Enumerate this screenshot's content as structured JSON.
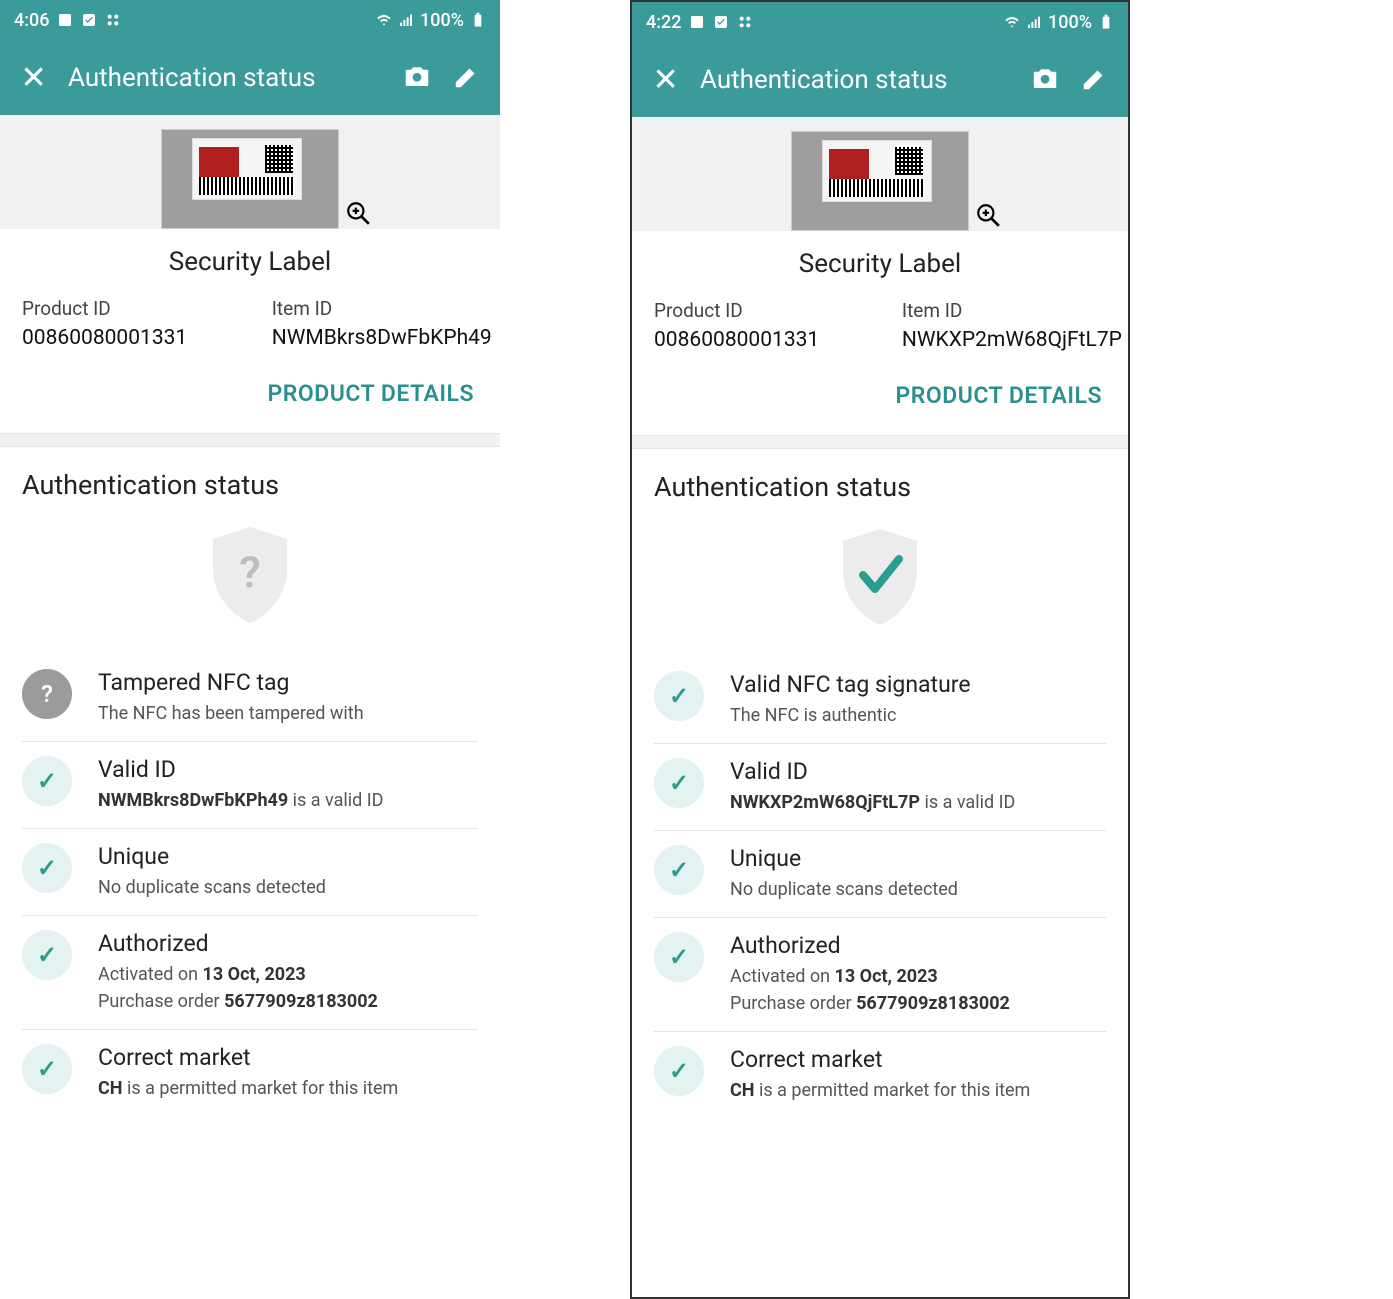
{
  "screens": [
    {
      "status_bar": {
        "time": "4:06",
        "battery": "100%"
      },
      "app_bar": {
        "title": "Authentication status"
      },
      "hero": {
        "label_title": "Security Label",
        "product_id_label": "Product ID",
        "product_id_value": "00860080001331",
        "item_id_label": "Item ID",
        "item_id_value": "NWMBkrs8DwFbKPh49",
        "details_link": "PRODUCT DETAILS"
      },
      "auth": {
        "section_title": "Authentication status",
        "shield_symbol": "?",
        "shield_ok": false,
        "items": [
          {
            "badge": "warn",
            "title": "Tampered NFC tag",
            "sub_prefix": "",
            "sub_bold": "",
            "sub_suffix": "The NFC has been tampered with",
            "extra_prefix": "",
            "extra_bold": "",
            "extra_suffix": ""
          },
          {
            "badge": "ok",
            "title": "Valid ID",
            "sub_prefix": "",
            "sub_bold": "NWMBkrs8DwFbKPh49",
            "sub_suffix": " is a valid ID",
            "extra_prefix": "",
            "extra_bold": "",
            "extra_suffix": ""
          },
          {
            "badge": "ok",
            "title": "Unique",
            "sub_prefix": "",
            "sub_bold": "",
            "sub_suffix": "No duplicate scans detected",
            "extra_prefix": "",
            "extra_bold": "",
            "extra_suffix": ""
          },
          {
            "badge": "ok",
            "title": "Authorized",
            "sub_prefix": "Activated on ",
            "sub_bold": "13 Oct, 2023",
            "sub_suffix": "",
            "extra_prefix": "Purchase order ",
            "extra_bold": "5677909z8183002",
            "extra_suffix": ""
          },
          {
            "badge": "ok",
            "title": "Correct market",
            "sub_prefix": "",
            "sub_bold": "CH",
            "sub_suffix": " is a permitted market for this item",
            "extra_prefix": "",
            "extra_bold": "",
            "extra_suffix": ""
          }
        ]
      }
    },
    {
      "status_bar": {
        "time": "4:22",
        "battery": "100%"
      },
      "app_bar": {
        "title": "Authentication status"
      },
      "hero": {
        "label_title": "Security Label",
        "product_id_label": "Product ID",
        "product_id_value": "00860080001331",
        "item_id_label": "Item ID",
        "item_id_value": "NWKXP2mW68QjFtL7P",
        "details_link": "PRODUCT DETAILS"
      },
      "auth": {
        "section_title": "Authentication status",
        "shield_symbol": "✓",
        "shield_ok": true,
        "items": [
          {
            "badge": "ok",
            "title": "Valid NFC tag signature",
            "sub_prefix": "",
            "sub_bold": "",
            "sub_suffix": "The NFC is authentic",
            "extra_prefix": "",
            "extra_bold": "",
            "extra_suffix": ""
          },
          {
            "badge": "ok",
            "title": "Valid ID",
            "sub_prefix": "",
            "sub_bold": "NWKXP2mW68QjFtL7P",
            "sub_suffix": " is a valid ID",
            "extra_prefix": "",
            "extra_bold": "",
            "extra_suffix": ""
          },
          {
            "badge": "ok",
            "title": "Unique",
            "sub_prefix": "",
            "sub_bold": "",
            "sub_suffix": "No duplicate scans detected",
            "extra_prefix": "",
            "extra_bold": "",
            "extra_suffix": ""
          },
          {
            "badge": "ok",
            "title": "Authorized",
            "sub_prefix": "Activated on ",
            "sub_bold": "13 Oct, 2023",
            "sub_suffix": "",
            "extra_prefix": "Purchase order ",
            "extra_bold": "5677909z8183002",
            "extra_suffix": ""
          },
          {
            "badge": "ok",
            "title": "Correct market",
            "sub_prefix": "",
            "sub_bold": "CH",
            "sub_suffix": " is a permitted market for this item",
            "extra_prefix": "",
            "extra_bold": "",
            "extra_suffix": ""
          }
        ]
      }
    }
  ]
}
